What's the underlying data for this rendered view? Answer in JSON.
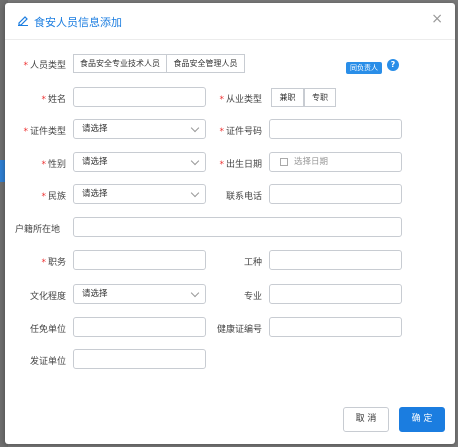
{
  "dialog": {
    "title": "食安人员信息添加",
    "close": "×"
  },
  "form": {
    "person_type": {
      "label": "人员类型",
      "options": [
        "食品安全专业技术人员",
        "食品安全管理人员"
      ],
      "badge": "同负责人",
      "help": "?"
    },
    "name": {
      "label": "姓名",
      "value": ""
    },
    "employment": {
      "label": "从业类型",
      "options": [
        "兼职",
        "专职"
      ]
    },
    "id_type": {
      "label": "证件类型",
      "value": "请选择"
    },
    "id_number": {
      "label": "证件号码",
      "value": ""
    },
    "gender": {
      "label": "性别",
      "value": "请选择"
    },
    "birth_date": {
      "label": "出生日期",
      "placeholder": "选择日期"
    },
    "ethnicity": {
      "label": "民族",
      "value": "请选择"
    },
    "phone": {
      "label": "联系电话",
      "value": ""
    },
    "household": {
      "label": "户籍所在地",
      "value": ""
    },
    "position": {
      "label": "职务",
      "value": ""
    },
    "job_type": {
      "label": "工种",
      "value": ""
    },
    "education": {
      "label": "文化程度",
      "value": "请选择"
    },
    "major": {
      "label": "专业",
      "value": ""
    },
    "appointing_unit": {
      "label": "任免单位",
      "value": ""
    },
    "health_cert": {
      "label": "健康证编号",
      "value": ""
    },
    "issuing_unit": {
      "label": "发证单位",
      "value": ""
    }
  },
  "footer": {
    "cancel": "取 消",
    "confirm": "确 定"
  },
  "colors": {
    "accent": "#1b7de0",
    "required": "#ee3333",
    "badge": "#2a8ee8"
  }
}
